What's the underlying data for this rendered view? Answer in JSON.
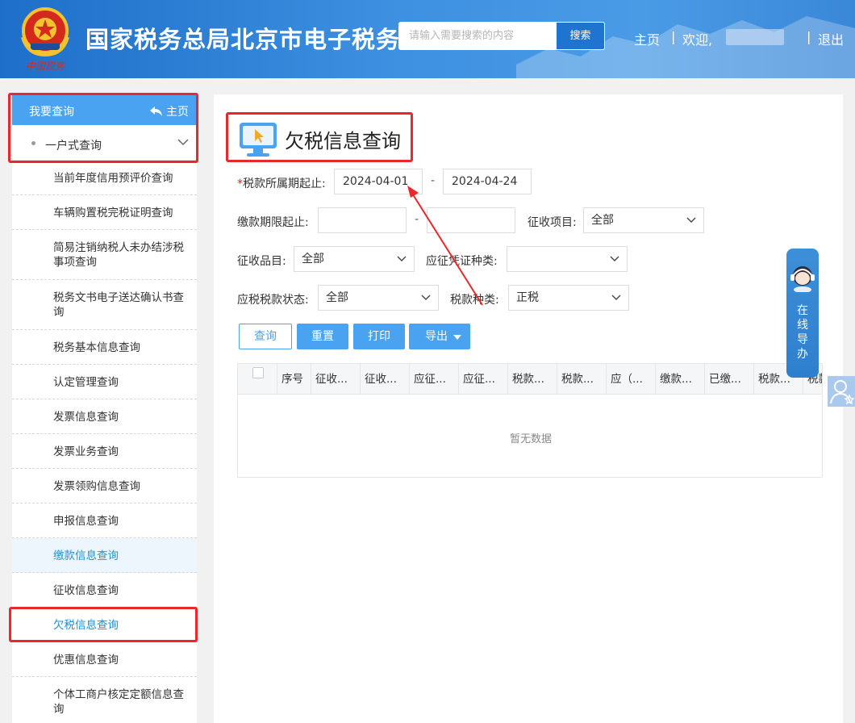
{
  "header": {
    "site_title": "国家税务总局北京市电子税务",
    "search_placeholder": "请输入需要搜索的内容",
    "search_button": "搜索",
    "nav_home": "主页",
    "nav_sep1": "|",
    "nav_welcome": "欢迎,",
    "nav_sep2": "|",
    "nav_logout": "退出"
  },
  "sidebar": {
    "title": "我要查询",
    "home": "主页",
    "group": "一户式查询",
    "items": [
      "当前年度信用预评价查询",
      "车辆购置税完税证明查询",
      "简易注销纳税人未办结涉税事项查询",
      "税务文书电子送达确认书查询",
      "税务基本信息查询",
      "认定管理查询",
      "发票信息查询",
      "发票业务查询",
      "发票领购信息查询",
      "申报信息查询",
      "缴款信息查询",
      "征收信息查询",
      "欠税信息查询",
      "优惠信息查询",
      "个体工商户核定定额信息查询"
    ]
  },
  "main": {
    "title": "欠税信息查询",
    "form": {
      "period_required": "*",
      "period_label": "税款所属期起止:",
      "period_start": "2024-04-01",
      "period_end": "2024-04-24",
      "dash": "-",
      "deadline_label": "缴款期限起止:",
      "item_label": "征收项目:",
      "item_value": "全部",
      "subitem_label": "征收品目:",
      "subitem_value": "全部",
      "voucher_label": "应征凭证种类:",
      "voucher_value": "",
      "status_label": "应税税款状态:",
      "status_value": "全部",
      "taxtype_label": "税款种类:",
      "taxtype_value": "正税"
    },
    "buttons": {
      "query": "查询",
      "reset": "重置",
      "print": "打印",
      "export": "导出"
    },
    "table": {
      "columns": [
        "序号",
        "征收...",
        "征收...",
        "应征...",
        "应征...",
        "税款...",
        "税款...",
        "应（...",
        "缴款...",
        "已缴...",
        "税款...",
        "税款"
      ],
      "empty": "暂无数据"
    }
  },
  "float": {
    "label_chars": [
      "在",
      "线",
      "导",
      "办"
    ]
  },
  "colors": {
    "header_blue": "#2a7dd4",
    "sidebar_head": "#4aa3f0",
    "highlight_red": "#e8282b",
    "accent_blue": "#4aa3f0"
  }
}
